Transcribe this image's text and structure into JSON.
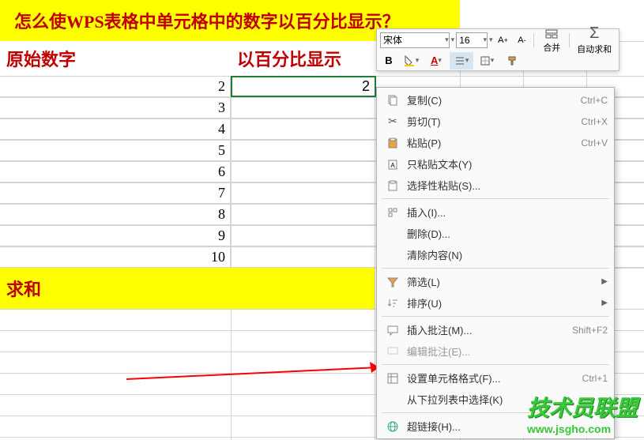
{
  "title": "怎么使WPS表格中单元格中的数字以百分比显示？",
  "headers": {
    "col_a": "原始数字",
    "col_b": "以百分比显示"
  },
  "data_rows": [
    "2",
    "3",
    "4",
    "5",
    "6",
    "7",
    "8",
    "9",
    "10"
  ],
  "selected_value": "2",
  "sum_label": "求和",
  "toolbar": {
    "font_name": "宋体",
    "font_size": "16",
    "bold": "B",
    "merge": "合并",
    "autosum": "自动求和"
  },
  "context_menu": {
    "copy": {
      "label": "复制(C)",
      "shortcut": "Ctrl+C"
    },
    "cut": {
      "label": "剪切(T)",
      "shortcut": "Ctrl+X"
    },
    "paste": {
      "label": "粘贴(P)",
      "shortcut": "Ctrl+V"
    },
    "paste_text": {
      "label": "只粘贴文本(Y)",
      "shortcut": ""
    },
    "paste_special": {
      "label": "选择性粘贴(S)...",
      "shortcut": ""
    },
    "insert": {
      "label": "插入(I)...",
      "shortcut": ""
    },
    "delete": {
      "label": "删除(D)...",
      "shortcut": ""
    },
    "clear": {
      "label": "清除内容(N)",
      "shortcut": ""
    },
    "filter": {
      "label": "筛选(L)",
      "shortcut": ""
    },
    "sort": {
      "label": "排序(U)",
      "shortcut": ""
    },
    "insert_comment": {
      "label": "插入批注(M)...",
      "shortcut": "Shift+F2"
    },
    "edit_comment": {
      "label": "编辑批注(E)...",
      "shortcut": ""
    },
    "format_cells": {
      "label": "设置单元格格式(F)...",
      "shortcut": "Ctrl+1"
    },
    "from_dropdown": {
      "label": "从下拉列表中选择(K)",
      "shortcut": ""
    },
    "hyperlink": {
      "label": "超链接(H)...",
      "shortcut": ""
    }
  },
  "watermark": {
    "text": "技术员联盟",
    "url": "www.jsgho.com"
  },
  "colors": {
    "highlight": "#ffff00",
    "heading_text": "#c00000",
    "selection_border": "#1a7f37",
    "watermark": "#38c838"
  }
}
